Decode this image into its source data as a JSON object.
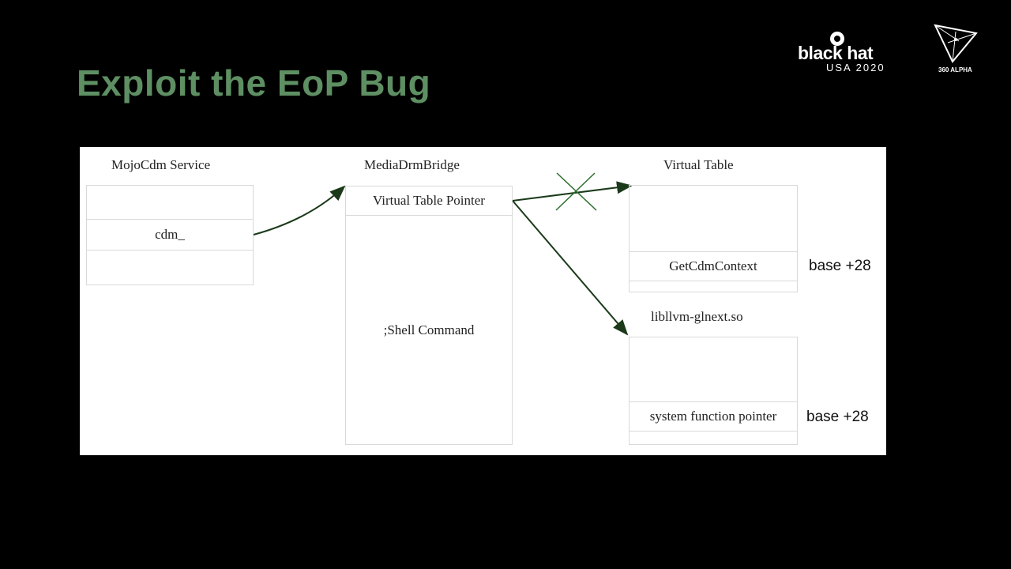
{
  "slide": {
    "title": "Exploit the EoP Bug"
  },
  "branding": {
    "blackhat_wordmark": "black hat",
    "blackhat_event": "USA 2020",
    "sponsor": "360 ALPHA"
  },
  "diagram": {
    "mojo": {
      "title": "MojoCdm Service",
      "field": "cdm_"
    },
    "bridge": {
      "title": "MediaDrmBridge",
      "vtable_pointer": "Virtual Table Pointer",
      "payload": ";Shell Command"
    },
    "vtable": {
      "title": "Virtual Table",
      "entry": "GetCdmContext",
      "offset": "base +28"
    },
    "lib": {
      "title": "libllvm-glnext.so",
      "entry": "system function pointer",
      "offset": "base +28"
    }
  }
}
